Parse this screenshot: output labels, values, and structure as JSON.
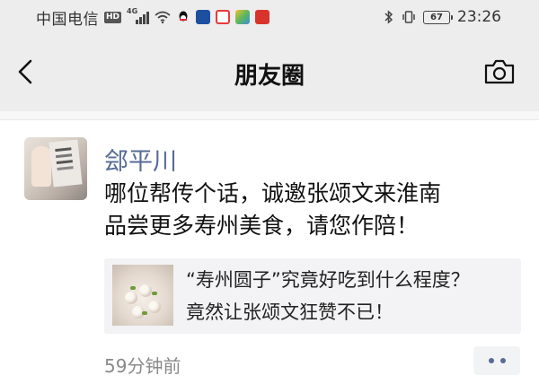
{
  "status_bar": {
    "carrier": "中国电信",
    "hd_badge": "HD",
    "network": "4G",
    "battery": "67",
    "time": "23:26",
    "app_icons": [
      {
        "name": "qq-icon",
        "color": "#111111"
      },
      {
        "name": "app-icon-blue",
        "color": "#1d4fa0"
      },
      {
        "name": "app-icon-red-square",
        "color": "#e63b3b"
      },
      {
        "name": "app-icon-colorful",
        "color": "#5cb85c"
      },
      {
        "name": "app-icon-red",
        "color": "#d9342b"
      }
    ]
  },
  "nav": {
    "title": "朋友圈",
    "back_icon": "chevron-left-icon",
    "camera_icon": "camera-icon"
  },
  "post": {
    "author": "郐平川",
    "content_lines": [
      "哪位帮传个话，诚邀张颂文来淮南",
      "品尝更多寿州美食，请您作陪！"
    ],
    "link": {
      "title_lines": [
        "“寿州圆子”究竟好吃到什么程度？",
        "竟然让张颂文狂赞不已！"
      ]
    },
    "timestamp": "59分钟前",
    "more_icon": "more-dots-icon"
  },
  "colors": {
    "author": "#576b95",
    "header_bg": "#ededed",
    "card_bg": "#f3f3f5"
  }
}
